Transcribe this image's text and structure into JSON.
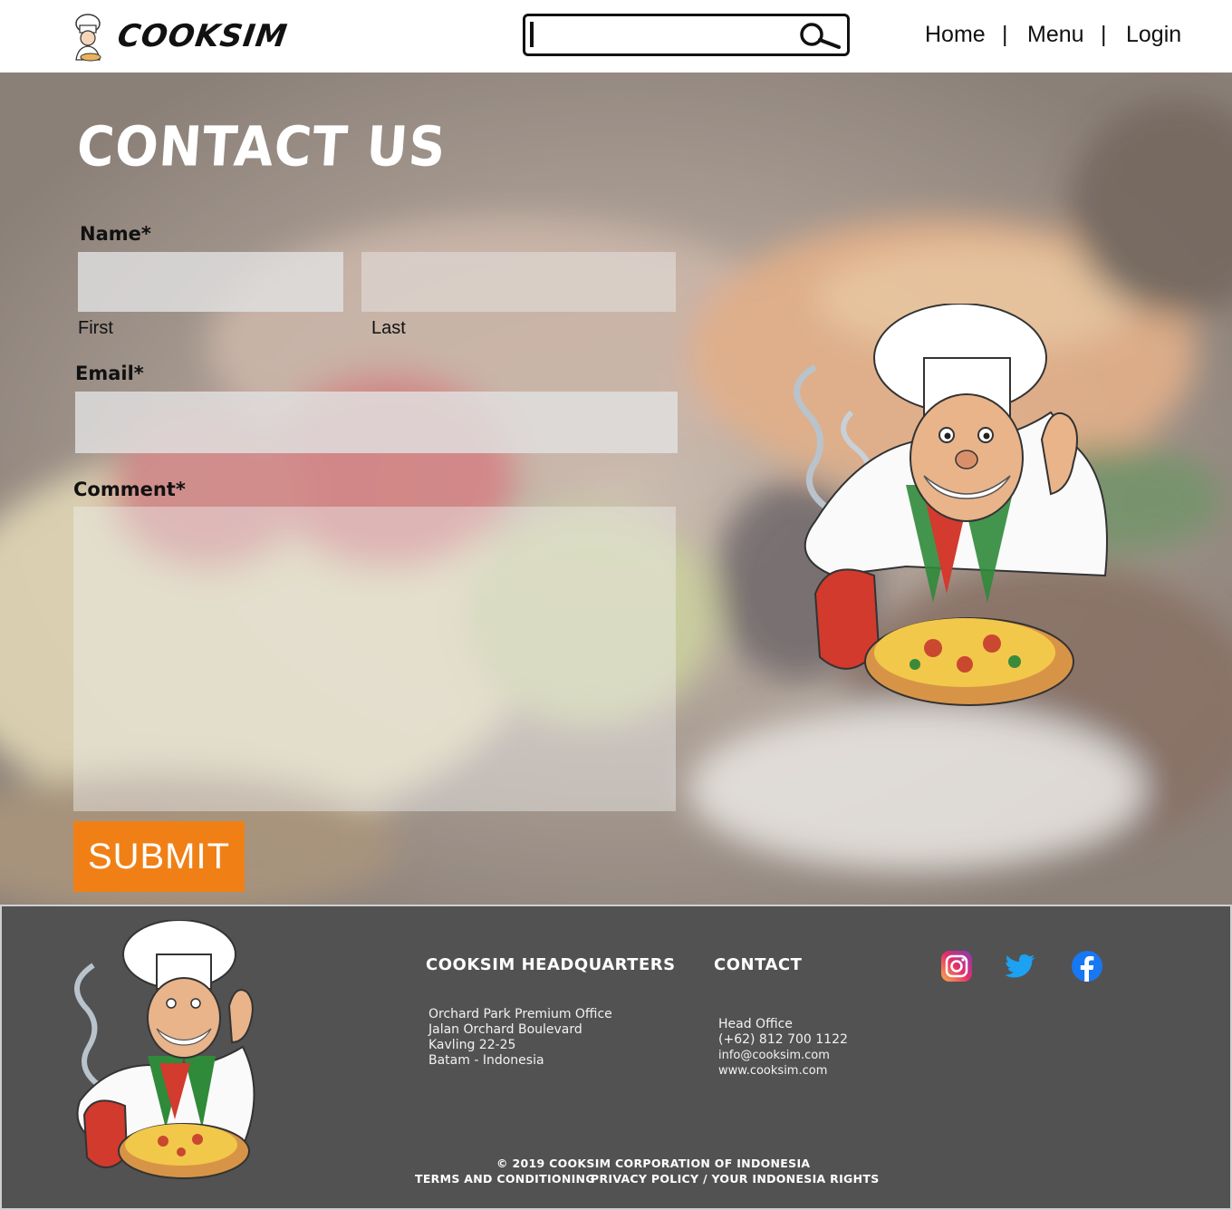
{
  "header": {
    "brand": "COOKSIM",
    "search": {
      "value": "",
      "placeholder": ""
    },
    "nav": [
      "Home",
      "Menu",
      "Login"
    ],
    "separator": "|"
  },
  "contact": {
    "title": "CONTACT US",
    "name_label": "Name*",
    "first_label": "First",
    "last_label": "Last",
    "email_label": "Email*",
    "comment_label": "Comment*",
    "first_value": "",
    "last_value": "",
    "email_value": "",
    "comment_value": "",
    "submit_label": "SUBMIT"
  },
  "footer": {
    "hq_title": "COOKSIM HEADQUARTERS",
    "hq_lines": [
      "Orchard Park Premium Office",
      "Jalan Orchard Boulevard",
      "Kavling 22-25",
      "Batam - Indonesia"
    ],
    "contact_title": "CONTACT",
    "contact_lines": [
      "Head Office",
      "(+62) 812 700 1122",
      "info@cooksim.com",
      "www.cooksim.com"
    ],
    "copyright": "© 2019 COOKSIM CORPORATION OF INDONESIA",
    "terms": "TERMS AND CONDITIONING",
    "privacy": "PRIVACY POLICY / YOUR INDONESIA RIGHTS",
    "social": [
      "instagram-icon",
      "twitter-icon",
      "facebook-icon"
    ]
  },
  "colors": {
    "accent": "#f08016",
    "footer_bg": "#525252",
    "header_bg": "#ffffff",
    "twitter": "#1da1f2",
    "facebook": "#1877f2"
  }
}
